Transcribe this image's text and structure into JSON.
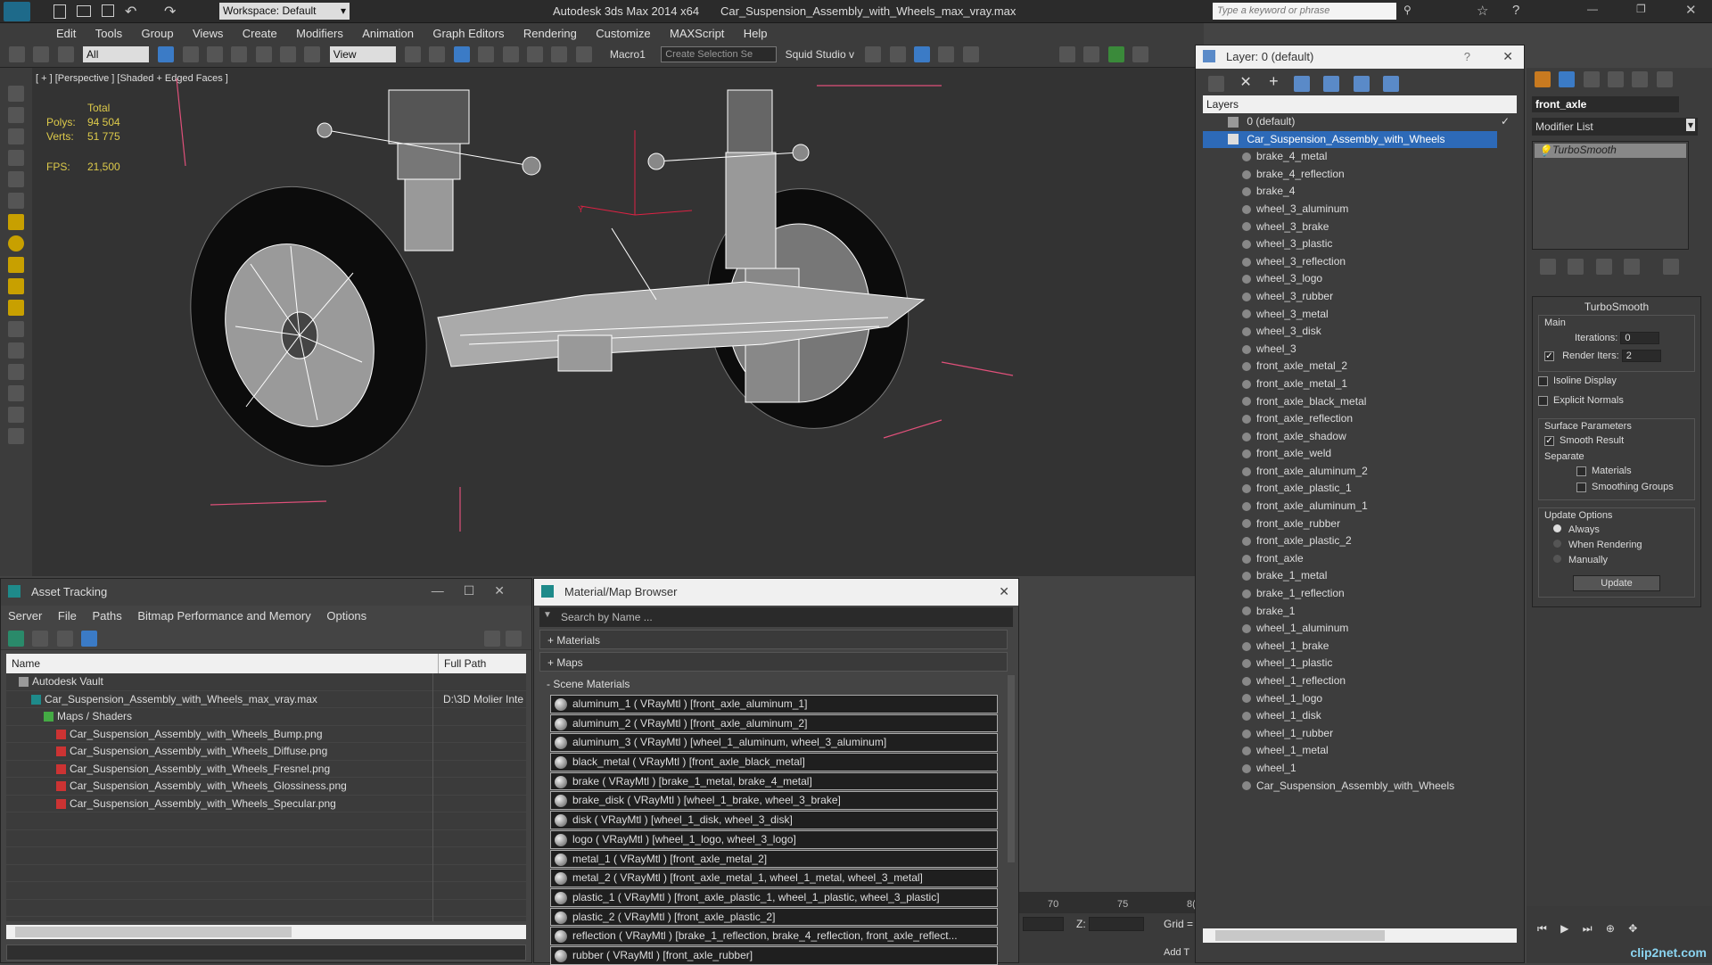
{
  "app": {
    "title": "Autodesk 3ds Max  2014 x64",
    "file": "Car_Suspension_Assembly_with_Wheels_max_vray.max",
    "workspace": "Workspace: Default",
    "search_placeholder": "Type a keyword or phrase"
  },
  "menu": [
    "Edit",
    "Tools",
    "Group",
    "Views",
    "Create",
    "Modifiers",
    "Animation",
    "Graph Editors",
    "Rendering",
    "Customize",
    "MAXScript",
    "Help"
  ],
  "toolbar": {
    "filter": "All",
    "view": "View",
    "macro": "Macro1",
    "selection_set": "Create Selection Se",
    "squid": "Squid Studio v"
  },
  "viewport": {
    "label": "[ + ] [Perspective ] [Shaded + Edged Faces ]",
    "stats_header": "Total",
    "polys_label": "Polys:",
    "polys_value": "94 504",
    "verts_label": "Verts:",
    "verts_value": "51 775",
    "fps_label": "FPS:",
    "fps_value": "21,500"
  },
  "asset_tracking": {
    "title": "Asset Tracking",
    "menu": [
      "Server",
      "File",
      "Paths",
      "Bitmap Performance and Memory",
      "Options"
    ],
    "col_name": "Name",
    "col_path": "Full Path",
    "rows": [
      {
        "indent": 1,
        "name": "Autodesk Vault",
        "path": ""
      },
      {
        "indent": 2,
        "name": "Car_Suspension_Assembly_with_Wheels_max_vray.max",
        "path": "D:\\3D Molier Inte"
      },
      {
        "indent": 3,
        "name": "Maps / Shaders",
        "path": ""
      },
      {
        "indent": 4,
        "name": "Car_Suspension_Assembly_with_Wheels_Bump.png",
        "path": ""
      },
      {
        "indent": 4,
        "name": "Car_Suspension_Assembly_with_Wheels_Diffuse.png",
        "path": ""
      },
      {
        "indent": 4,
        "name": "Car_Suspension_Assembly_with_Wheels_Fresnel.png",
        "path": ""
      },
      {
        "indent": 4,
        "name": "Car_Suspension_Assembly_with_Wheels_Glossiness.png",
        "path": ""
      },
      {
        "indent": 4,
        "name": "Car_Suspension_Assembly_with_Wheels_Specular.png",
        "path": ""
      }
    ]
  },
  "material_browser": {
    "title": "Material/Map Browser",
    "search_placeholder": "Search by Name ...",
    "section_materials": "+ Materials",
    "section_maps": "+ Maps",
    "section_scene": "- Scene Materials",
    "materials": [
      "aluminum_1  ( VRayMtl )  [front_axle_aluminum_1]",
      "aluminum_2  ( VRayMtl )  [front_axle_aluminum_2]",
      "aluminum_3  ( VRayMtl )  [wheel_1_aluminum, wheel_3_aluminum]",
      "black_metal  ( VRayMtl )  [front_axle_black_metal]",
      "brake  ( VRayMtl )  [brake_1_metal, brake_4_metal]",
      "brake_disk  ( VRayMtl )  [wheel_1_brake, wheel_3_brake]",
      "disk  ( VRayMtl )  [wheel_1_disk, wheel_3_disk]",
      "logo  ( VRayMtl )  [wheel_1_logo, wheel_3_logo]",
      "metal_1  ( VRayMtl )  [front_axle_metal_2]",
      "metal_2  ( VRayMtl )  [front_axle_metal_1, wheel_1_metal, wheel_3_metal]",
      "plastic_1  ( VRayMtl )  [front_axle_plastic_1, wheel_1_plastic, wheel_3_plastic]",
      "plastic_2  ( VRayMtl )  [front_axle_plastic_2]",
      "reflection  ( VRayMtl )  [brake_1_reflection, brake_4_reflection, front_axle_reflect...",
      "rubber  ( VRayMtl )  [front_axle_rubber]"
    ]
  },
  "timeline": {
    "ticks": [
      "70",
      "75",
      "8("
    ],
    "z_label": "Z:",
    "grid_label": "Grid =",
    "add_label": "Add T"
  },
  "layers": {
    "title": "Layer: 0 (default)",
    "header": "Layers",
    "default_layer": "0 (default)",
    "selected_layer": "Car_Suspension_Assembly_with_Wheels",
    "objects": [
      "brake_4_metal",
      "brake_4_reflection",
      "brake_4",
      "wheel_3_aluminum",
      "wheel_3_brake",
      "wheel_3_plastic",
      "wheel_3_reflection",
      "wheel_3_logo",
      "wheel_3_rubber",
      "wheel_3_metal",
      "wheel_3_disk",
      "wheel_3",
      "front_axle_metal_2",
      "front_axle_metal_1",
      "front_axle_black_metal",
      "front_axle_reflection",
      "front_axle_shadow",
      "front_axle_weld",
      "front_axle_aluminum_2",
      "front_axle_plastic_1",
      "front_axle_aluminum_1",
      "front_axle_rubber",
      "front_axle_plastic_2",
      "front_axle",
      "brake_1_metal",
      "brake_1_reflection",
      "brake_1",
      "wheel_1_aluminum",
      "wheel_1_brake",
      "wheel_1_plastic",
      "wheel_1_reflection",
      "wheel_1_logo",
      "wheel_1_disk",
      "wheel_1_rubber",
      "wheel_1_metal",
      "wheel_1",
      "Car_Suspension_Assembly_with_Wheels"
    ]
  },
  "command_panel": {
    "object_name": "front_axle",
    "modifier_list": "Modifier List",
    "stack_item": "TurboSmooth",
    "rollout_title": "TurboSmooth",
    "main_label": "Main",
    "iterations_label": "Iterations:",
    "iterations_value": "0",
    "render_iters_label": "Render Iters:",
    "render_iters_value": "2",
    "isoline": "Isoline Display",
    "explicit_normals": "Explicit Normals",
    "surface_params": "Surface Parameters",
    "smooth_result": "Smooth Result",
    "separate": "Separate",
    "materials": "Materials",
    "smoothing_groups": "Smoothing Groups",
    "update_options": "Update Options",
    "always": "Always",
    "when_rendering": "When Rendering",
    "manually": "Manually",
    "update_button": "Update"
  },
  "watermark": "clip2net.com"
}
